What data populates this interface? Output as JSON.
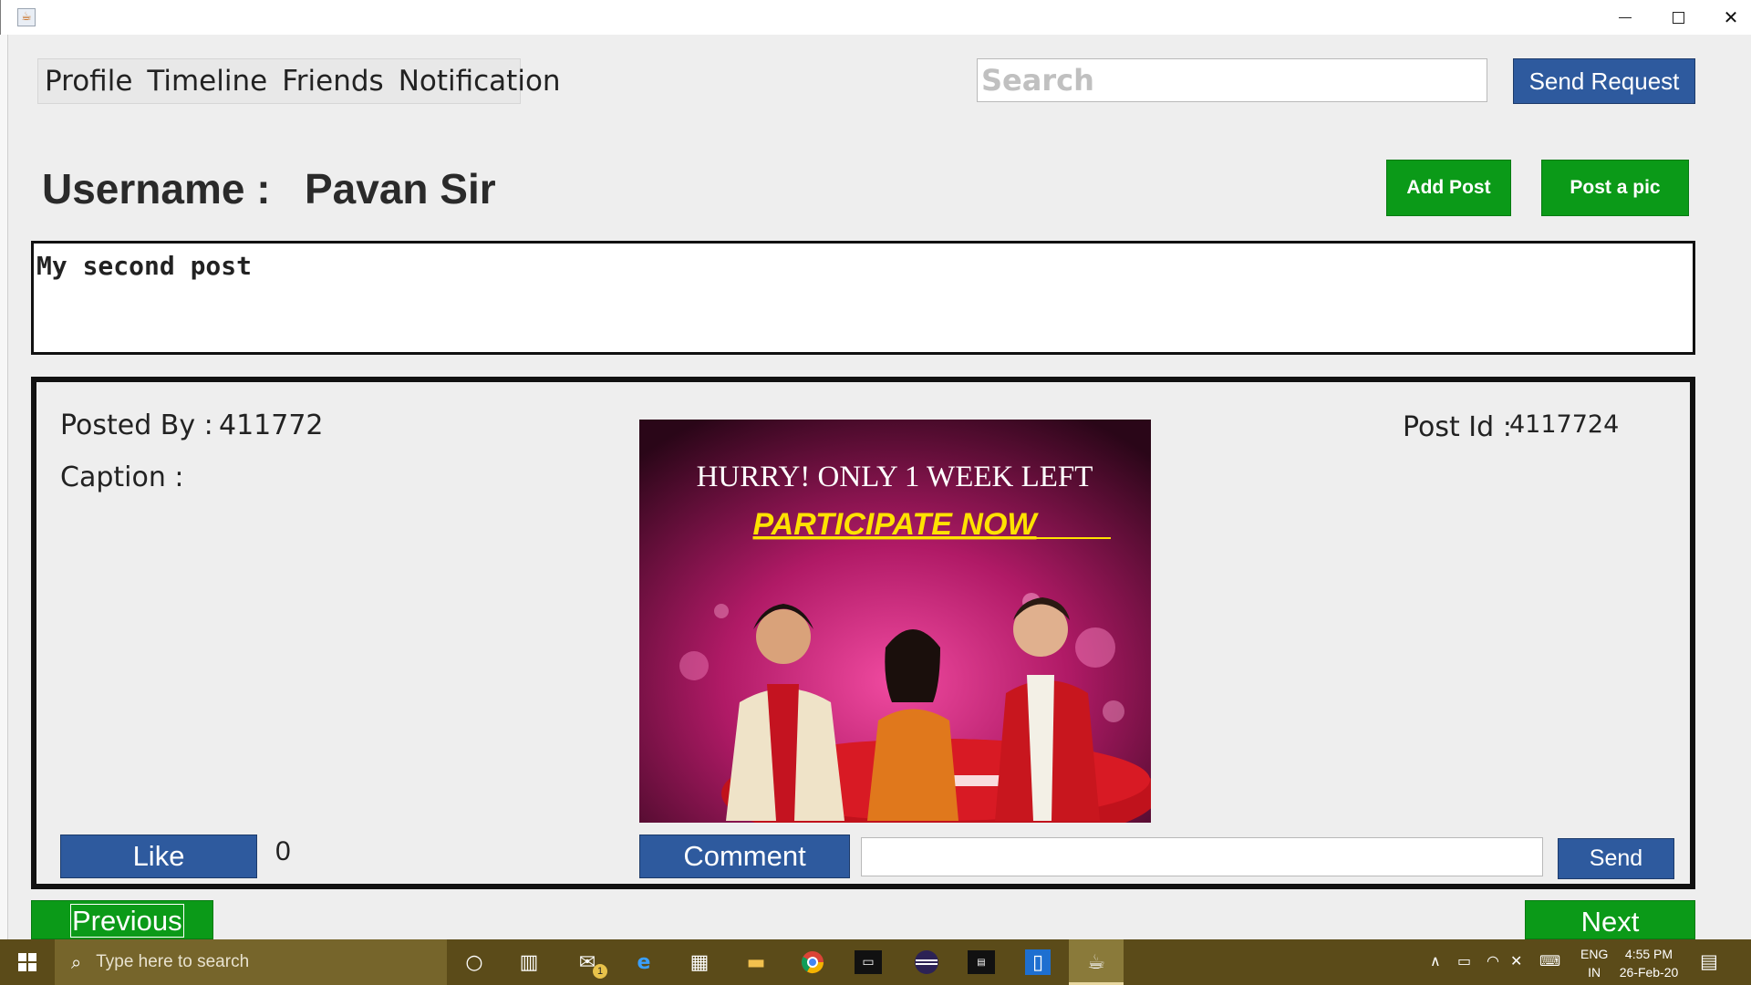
{
  "window": {
    "minimize_glyph": "—",
    "close_glyph": "✕"
  },
  "menu": {
    "items": [
      "Profile",
      "Timeline",
      "Friends",
      "Notification"
    ]
  },
  "search": {
    "placeholder": "Search",
    "button_label": "Send Request"
  },
  "user": {
    "label": "Username :",
    "name": "Pavan Sir"
  },
  "actions": {
    "add_post": "Add Post",
    "post_pic": "Post a pic"
  },
  "composer": {
    "value": "My second post"
  },
  "post": {
    "posted_by_label": "Posted By :",
    "posted_by_value": "411772",
    "caption_label": "Caption :",
    "post_id_label": "Post Id :",
    "post_id_value": "4117724",
    "image_headline": "HURRY! ONLY 1 WEEK LEFT",
    "image_cta": "PARTICIPATE  NOW",
    "like_label": "Like",
    "like_count": "0",
    "comment_label": "Comment",
    "comment_value": "",
    "send_label": "Send"
  },
  "pagination": {
    "previous": "Previous",
    "next": "Next"
  },
  "taskbar": {
    "search_placeholder": "Type here to search",
    "language_line1": "ENG",
    "language_line2": "IN",
    "time": "4:55 PM",
    "date": "26-Feb-20",
    "mail_badge": "1"
  },
  "colors": {
    "primary_blue": "#2e5a9e",
    "action_green": "#0b9a18",
    "taskbar": "#5b4b19"
  }
}
